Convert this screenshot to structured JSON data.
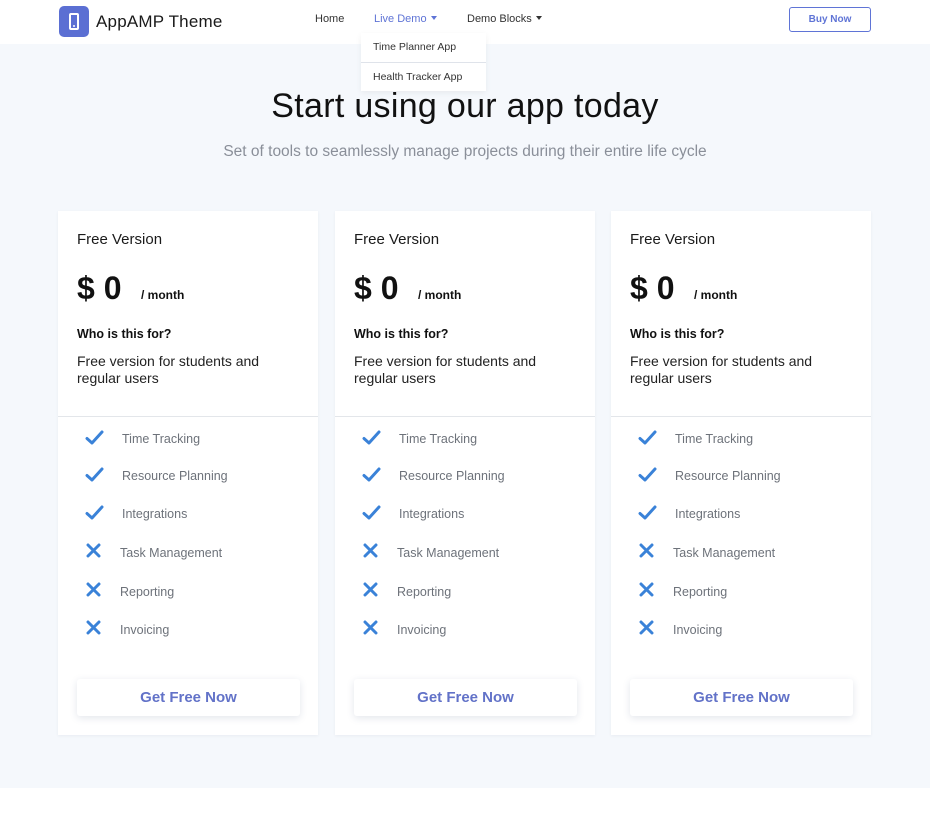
{
  "header": {
    "brand": "AppAMP Theme",
    "nav": [
      {
        "label": "Home"
      },
      {
        "label": "Live Demo"
      },
      {
        "label": "Demo Blocks"
      }
    ],
    "cta_label": "Buy Now",
    "dropdown": [
      "Time Planner App",
      "Health Tracker App"
    ]
  },
  "hero": {
    "title": "Start using our app today",
    "subtitle": "Set of tools to seamlessly manage projects during their entire life cycle"
  },
  "colors": {
    "accent": "#5f74d6",
    "check": "#3a82d8",
    "section_bg": "#f5f8fc"
  },
  "cards": [
    {
      "plan": "Free Version",
      "price": "$ 0",
      "period": "/ month",
      "who": "Who is this for?",
      "desc": "Free version for students and regular users",
      "features": [
        {
          "label": "Time Tracking",
          "included": true
        },
        {
          "label": "Resource Planning",
          "included": true
        },
        {
          "label": "Integrations",
          "included": true
        },
        {
          "label": "Task Management",
          "included": false
        },
        {
          "label": "Reporting",
          "included": false
        },
        {
          "label": "Invoicing",
          "included": false
        }
      ],
      "cta": "Get Free Now"
    },
    {
      "plan": "Free Version",
      "price": "$ 0",
      "period": "/ month",
      "who": "Who is this for?",
      "desc": "Free version for students and regular users",
      "features": [
        {
          "label": "Time Tracking",
          "included": true
        },
        {
          "label": "Resource Planning",
          "included": true
        },
        {
          "label": "Integrations",
          "included": true
        },
        {
          "label": "Task Management",
          "included": false
        },
        {
          "label": "Reporting",
          "included": false
        },
        {
          "label": "Invoicing",
          "included": false
        }
      ],
      "cta": "Get Free Now"
    },
    {
      "plan": "Free Version",
      "price": "$ 0",
      "period": "/ month",
      "who": "Who is this for?",
      "desc": "Free version for students and regular users",
      "features": [
        {
          "label": "Time Tracking",
          "included": true
        },
        {
          "label": "Resource Planning",
          "included": true
        },
        {
          "label": "Integrations",
          "included": true
        },
        {
          "label": "Task Management",
          "included": false
        },
        {
          "label": "Reporting",
          "included": false
        },
        {
          "label": "Invoicing",
          "included": false
        }
      ],
      "cta": "Get Free Now"
    }
  ]
}
